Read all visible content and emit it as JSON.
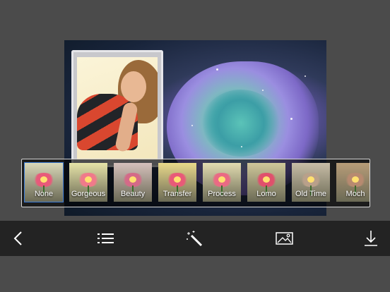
{
  "editor": {
    "filters": [
      {
        "label": "None",
        "selected": true,
        "tint": "#e85a7a",
        "bg": "#d9d7b8"
      },
      {
        "label": "Gorgeous",
        "selected": false,
        "tint": "#f07a8a",
        "bg": "#e6e3a8"
      },
      {
        "label": "Beauty",
        "selected": false,
        "tint": "#d46a88",
        "bg": "#d5c0bc"
      },
      {
        "label": "Transfer",
        "selected": false,
        "tint": "#e85a78",
        "bg": "#e8d88a"
      },
      {
        "label": "Process",
        "selected": false,
        "tint": "#ea6a84",
        "bg": "#e2dcb0"
      },
      {
        "label": "Lomo",
        "selected": false,
        "tint": "#e0506c",
        "bg": "#cfc79a"
      },
      {
        "label": "Old Time",
        "selected": false,
        "tint": "#b9a08a",
        "bg": "#c7bca6"
      },
      {
        "label": "Moch",
        "selected": false,
        "tint": "#b78a70",
        "bg": "#b79c78"
      }
    ]
  },
  "toolbar": {
    "items": [
      {
        "name": "back-button",
        "icon": "chevron-left-icon"
      },
      {
        "name": "menu-list-button",
        "icon": "list-icon"
      },
      {
        "name": "magic-wand-button",
        "icon": "magic-wand-icon"
      },
      {
        "name": "image-button",
        "icon": "image-icon"
      },
      {
        "name": "download-button",
        "icon": "download-icon"
      }
    ]
  }
}
